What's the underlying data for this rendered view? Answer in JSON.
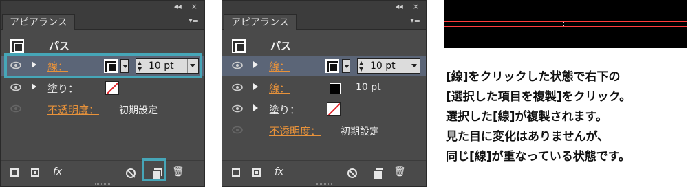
{
  "panels": [
    {
      "title": "アピアランス",
      "header_collapse": "◂◂",
      "header_close": "×",
      "menu_icon": "▾≡",
      "path_label": "パス",
      "rows": [
        {
          "label": "線：",
          "swatch": "stroke-icon",
          "weight": "10 pt",
          "highlighted": true
        },
        {
          "label": "塗り：",
          "swatch": "fill-none-icon"
        },
        {
          "label": "不透明度：",
          "value": "初期設定"
        }
      ],
      "bottom_icons": [
        "new-stroke-icon",
        "new-fill-icon",
        "fx-icon",
        "clear-icon",
        "duplicate-icon",
        "trash-icon"
      ],
      "fx_label": "fx",
      "trash_glyph": "🗑"
    },
    {
      "title": "アピアランス",
      "header_collapse": "◂◂",
      "header_close": "×",
      "menu_icon": "▾≡",
      "path_label": "パス",
      "rows": [
        {
          "label": "線：",
          "swatch": "stroke-icon",
          "weight": "10 pt",
          "highlighted": true
        },
        {
          "label": "線：",
          "swatch": "black-swatch",
          "weight": "10 pt"
        },
        {
          "label": "塗り：",
          "swatch": "fill-none-icon"
        },
        {
          "label": "不透明度：",
          "value": "初期設定"
        }
      ],
      "fx_label": "fx",
      "trash_glyph": "🗑"
    }
  ],
  "annotation_color": "#46a6b8",
  "description": [
    "[線]をクリックした状態で右下の",
    "[選択した項目を複製]をクリック。",
    "選択した[線]が複製されます。",
    "見た目に変化はありませんが、",
    "同じ[線]が重なっている状態です。"
  ]
}
